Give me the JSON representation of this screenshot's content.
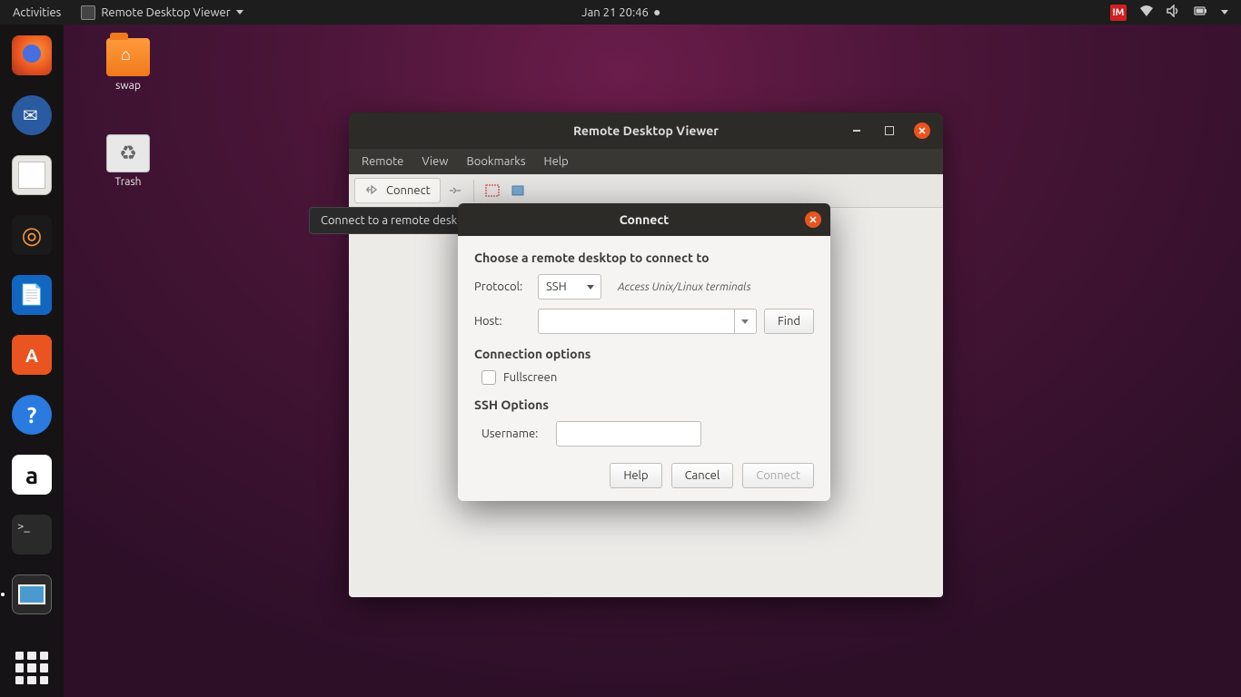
{
  "panel": {
    "activities": "Activities",
    "app_menu": "Remote Desktop Viewer",
    "clock": "Jan 21  20:46",
    "nm_badge": "!M"
  },
  "desktop": {
    "swap": "swap",
    "trash": "Trash"
  },
  "tooltip": "Connect to a remote desktop",
  "window": {
    "title": "Remote Desktop Viewer",
    "menu": {
      "remote": "Remote",
      "view": "View",
      "bookmarks": "Bookmarks",
      "help": "Help"
    },
    "toolbar": {
      "connect": "Connect"
    }
  },
  "dialog": {
    "title": "Connect",
    "heading": "Choose a remote desktop to connect to",
    "protocol_label": "Protocol:",
    "protocol_value": "SSH",
    "protocol_hint": "Access Unix/Linux terminals",
    "host_label": "Host:",
    "host_value": "",
    "find": "Find",
    "conn_options": "Connection options",
    "fullscreen": "Fullscreen",
    "ssh_options": "SSH Options",
    "username_label": "Username:",
    "username_value": "",
    "help": "Help",
    "cancel": "Cancel",
    "connect": "Connect"
  }
}
